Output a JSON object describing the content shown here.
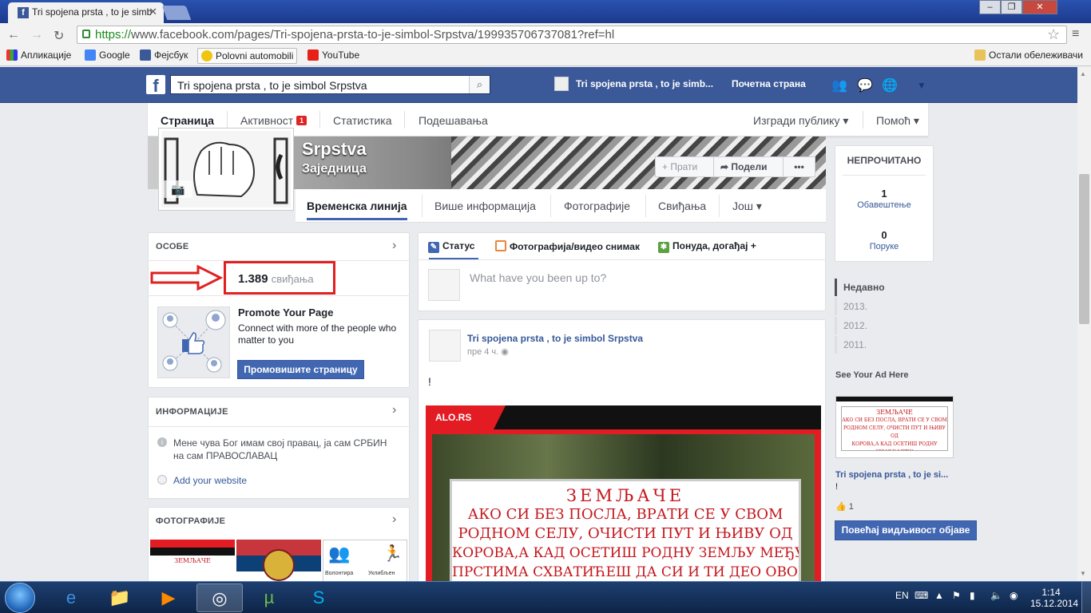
{
  "browser": {
    "tab_title": "Tri spojena prsta , to je simb",
    "url_scheme": "https://",
    "url_rest": "www.facebook.com/pages/Tri-spojena-prsta-to-je-simbol-Srpstva/199935706737081?ref=hl",
    "bookmarks": [
      "Апликације",
      "Google",
      "Фејсбук",
      "Polovni automobili",
      "YouTube"
    ],
    "other_bookmarks": "Остали обележивачи"
  },
  "fb_header": {
    "search_value": "Tri spojena prsta , to je simbol Srpstva",
    "page_link": "Tri spojena prsta , to je simb...",
    "home": "Почетна страна"
  },
  "page_nav": {
    "page": "Страница",
    "activity": "Активност",
    "activity_badge": "1",
    "stats": "Статистика",
    "settings": "Подешавања",
    "build_audience": "Изгради публику ▾",
    "help": "Помоћ ▾"
  },
  "cover": {
    "name": "Srpstva",
    "category": "Заједница",
    "follow": "Прати",
    "share": "Подели",
    "more": "•••"
  },
  "subnav": [
    "Временска линија",
    "Више информација",
    "Фотографије",
    "Свиђања",
    "Још ▾"
  ],
  "people": {
    "header": "ОСОБЕ",
    "likes_count": "1.389",
    "likes_label": "свиђања",
    "promote_title": "Promote Your Page",
    "promote_text": "Connect with more of the people who matter to you",
    "promote_button": "Промовишите страницу"
  },
  "info": {
    "header": "ИНФОРМАЦИЈЕ",
    "about": "Мене чува Бог имам свој правац, ја сам СРБИН на сам ПРАВОСЛАВАЦ",
    "website": "Add your website"
  },
  "photos": {
    "header": "ФОТОГРАФИЈЕ",
    "thumb3_labels": [
      "Волонтира",
      "Уклибљен"
    ]
  },
  "composer": {
    "status": "Статус",
    "photo_video": "Фотографија/видео снимак",
    "offer_event": "Понуда, догађај +",
    "placeholder": "What have you been up to?"
  },
  "post": {
    "author": "Tri spojena prsta , to je simbol Srpstva",
    "time": "пре 4 ч.",
    "text": "!",
    "image_brand": "ALO.RS",
    "sign_lines": [
      "ЗЕМЉАЧЕ",
      "АКО СИ БЕЗ ПОСЛА, ВРАТИ СЕ У СВОМ",
      "РОДНОМ СЕЛУ, ОЧИСТИ ПУТ И ЊИВУ ОД",
      "КОРОВА,А КАД ОСЕТИШ РОДНУ ЗЕМЉУ МЕЂУ",
      "ПРСТИМА СХВАТИЋЕШ ДА СИ И ТИ ДЕО ОВОГ"
    ]
  },
  "right": {
    "unread_header": "НЕПРОЧИТАНО",
    "notifications_count": "1",
    "notifications_label": "Обавештење",
    "messages_count": "0",
    "messages_label": "Поруке",
    "timeline": [
      "Недавно",
      "2013.",
      "2012.",
      "2011."
    ],
    "ad_header": "See Your Ad Here",
    "ad_title": "Tri spojena prsta , to je si...",
    "ad_text": "!",
    "ad_likes": "1",
    "boost_button": "Повећај видљивост објаве"
  },
  "taskbar": {
    "lang": "EN",
    "time": "1:14",
    "date": "15.12.2014"
  },
  "colors": {
    "fb_blue": "#3b5998",
    "highlight_red": "#e02020"
  }
}
